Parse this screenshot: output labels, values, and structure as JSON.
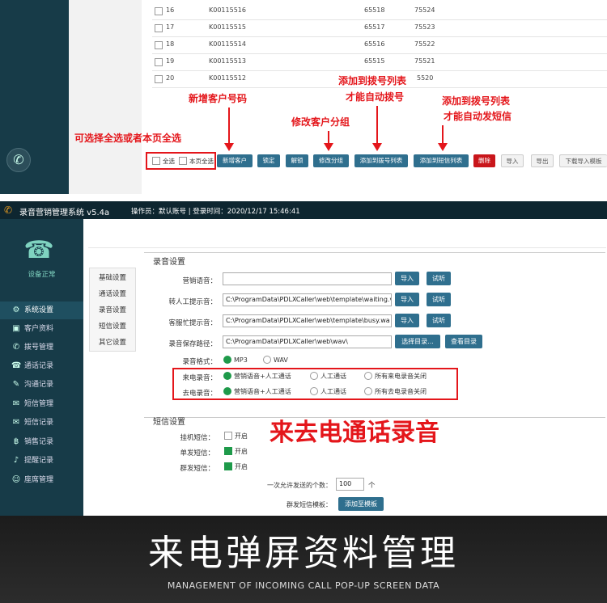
{
  "top": {
    "rows": [
      {
        "n": "16",
        "code": "K00115516",
        "a": "65518",
        "b": "75524"
      },
      {
        "n": "17",
        "code": "K00115515",
        "a": "65517",
        "b": "75523"
      },
      {
        "n": "18",
        "code": "K00115514",
        "a": "65516",
        "b": "75522"
      },
      {
        "n": "19",
        "code": "K00115513",
        "a": "65515",
        "b": "75521"
      },
      {
        "n": "20",
        "code": "K00115512",
        "a": "",
        "b": "5520"
      }
    ],
    "select_all": "全选",
    "select_page": "本页全选",
    "buttons": {
      "add_customer": "新增客户",
      "lock": "锁定",
      "unlock": "解锁",
      "change_group": "修改分组",
      "add_dial_list": "添加到拨号列表",
      "add_sms_list": "添加到短信列表",
      "delete": "删除",
      "import": "导入",
      "export": "导出",
      "download_template": "下载导入模板"
    },
    "annotations": {
      "select": "可选择全选或者本页全选",
      "add_customer": "新增客户号码",
      "change_group": "修改客户分组",
      "dial_line1": "添加到拨号列表",
      "dial_line2": "才能自动拨号",
      "sms_line1": "添加到拨号列表",
      "sms_line2": "才能自动发短信"
    }
  },
  "app": {
    "title": "录音营销管理系统 v5.4a",
    "operator": "操作员：默认账号 | 登录时间：2020/12/17 15:46:41",
    "device_status": "设备正常"
  },
  "sidebar": {
    "items": [
      {
        "label": "系统设置",
        "icon": "gear-icon",
        "glyph": "⚙"
      },
      {
        "label": "客户资料",
        "icon": "contact-card-icon",
        "glyph": "▣"
      },
      {
        "label": "拨号管理",
        "icon": "phone-icon",
        "glyph": "✆"
      },
      {
        "label": "通话记录",
        "icon": "call-log-icon",
        "glyph": "☎"
      },
      {
        "label": "沟通记录",
        "icon": "note-icon",
        "glyph": "✎"
      },
      {
        "label": "短信管理",
        "icon": "message-icon",
        "glyph": "✉"
      },
      {
        "label": "短信记录",
        "icon": "sms-log-icon",
        "glyph": "✉"
      },
      {
        "label": "销售记录",
        "icon": "sales-icon",
        "glyph": "฿"
      },
      {
        "label": "提醒记录",
        "icon": "bell-icon",
        "glyph": "♪"
      },
      {
        "label": "座席管理",
        "icon": "agents-icon",
        "glyph": "☺"
      }
    ]
  },
  "subnav": [
    "基础设置",
    "通话设置",
    "录音设置",
    "短信设置",
    "其它设置"
  ],
  "recording": {
    "section_title": "录音设置",
    "marketing_voice_label": "营销语音：",
    "marketing_voice_value": "",
    "transfer_prompt_label": "转人工提示音：",
    "transfer_prompt_value": "C:\\ProgramData\\PDLXCaller\\web\\template\\waiting.v",
    "busy_prompt_label": "客服忙提示音：",
    "busy_prompt_value": "C:\\ProgramData\\PDLXCaller\\web\\template\\busy.wa",
    "save_path_label": "录音保存路径：",
    "save_path_value": "C:\\ProgramData\\PDLXCaller\\web\\wav\\",
    "import_label": "导入",
    "listen_label": "试听",
    "choose_dir": "选择目录...",
    "view_dir": "查看目录",
    "format_label": "录音格式：",
    "format_mp3": "MP3",
    "format_wav": "WAV",
    "incoming_label": "来电录音：",
    "outgoing_label": "去电录音：",
    "opt_both": "营销语音+人工通话",
    "opt_manual": "人工通话",
    "opt_in_off": "所有来电录音关闭",
    "opt_out_off": "所有去电录音关闭"
  },
  "sms": {
    "section_title": "短信设置",
    "hangup_label": "挂机短信：",
    "single_label": "单发短信：",
    "group_label": "群发短信：",
    "enable": "开启",
    "max_count_label": "一次允许发送的个数：",
    "max_count_value": "100",
    "unit": "个",
    "template_label": "群发短信模板：",
    "add_template": "添加至模板"
  },
  "big_annotation": "来去电通话录音",
  "banner": {
    "title": "来电弹屏资料管理",
    "subtitle": "MANAGEMENT OF INCOMING CALL POP-UP SCREEN DATA"
  },
  "colors": {
    "sidebar": "#173b48",
    "accent": "#2f6f8e",
    "annotation": "#e4161b",
    "check": "#1e9a4a"
  }
}
